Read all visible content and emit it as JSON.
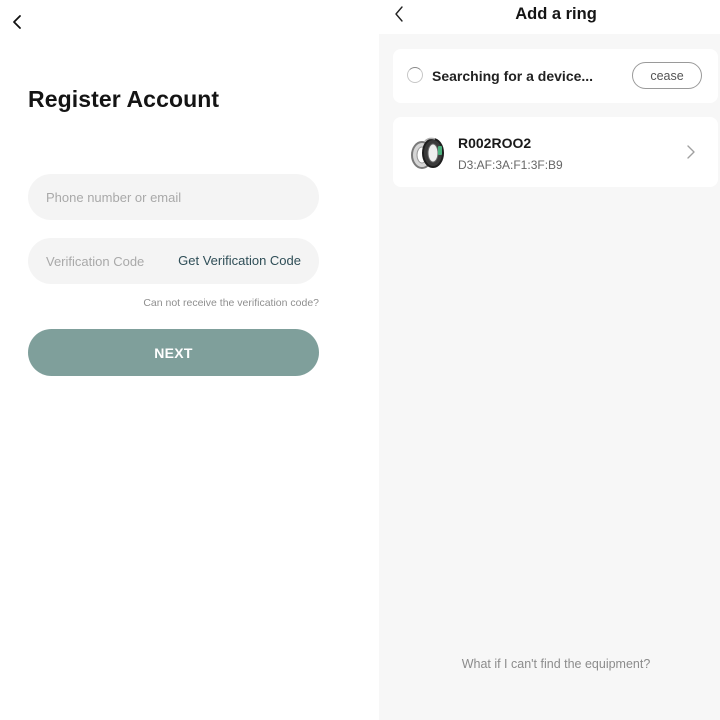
{
  "register": {
    "back_icon": "chevron-left-icon",
    "title": "Register Account",
    "phone_placeholder": "Phone number or email",
    "code_placeholder": "Verification Code",
    "get_code_label": "Get Verification Code",
    "cant_receive_text": "Can not receive the verification code?",
    "next_label": "NEXT",
    "next_button_color": "#7f9f9b",
    "input_background": "#f4f4f4"
  },
  "add_ring": {
    "back_icon": "chevron-left-icon",
    "title": "Add a ring",
    "search_status": "Searching for a device...",
    "cease_label": "cease",
    "devices": [
      {
        "name": "R002ROO2",
        "mac": "D3:AF:3A:F1:3F:B9",
        "icon": "ring-device-icon"
      }
    ],
    "help_text": "What if I can't find the equipment?",
    "background": "#f7f7f7"
  }
}
